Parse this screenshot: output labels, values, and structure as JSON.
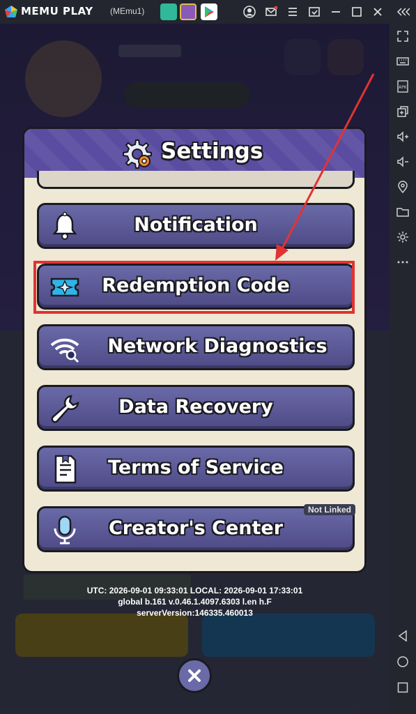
{
  "titlebar": {
    "brand": "MEMU PLAY",
    "instance": "(MEmu1)"
  },
  "settings": {
    "title": "Settings",
    "items": [
      {
        "label": "Notification",
        "icon": "bell-icon"
      },
      {
        "label": "Redemption Code",
        "icon": "ticket-icon"
      },
      {
        "label": "Network Diagnostics",
        "icon": "wifi-search-icon"
      },
      {
        "label": "Data Recovery",
        "icon": "wrench-icon"
      },
      {
        "label": "Terms of Service",
        "icon": "document-icon"
      },
      {
        "label": "Creator's Center",
        "icon": "microphone-icon",
        "badge": "Not Linked"
      }
    ]
  },
  "info": {
    "time": "UTC: 2026-09-01 09:33:01 LOCAL: 2026-09-01 17:33:01",
    "build": "global b.161 v.0.46.1.4097.6303 l.en h.F",
    "server": "serverVersion:146335.460013"
  },
  "colors": {
    "highlight": "#e03434",
    "row": "#5a5898",
    "header": "#5a4ca0",
    "panel": "#efe8d4"
  }
}
